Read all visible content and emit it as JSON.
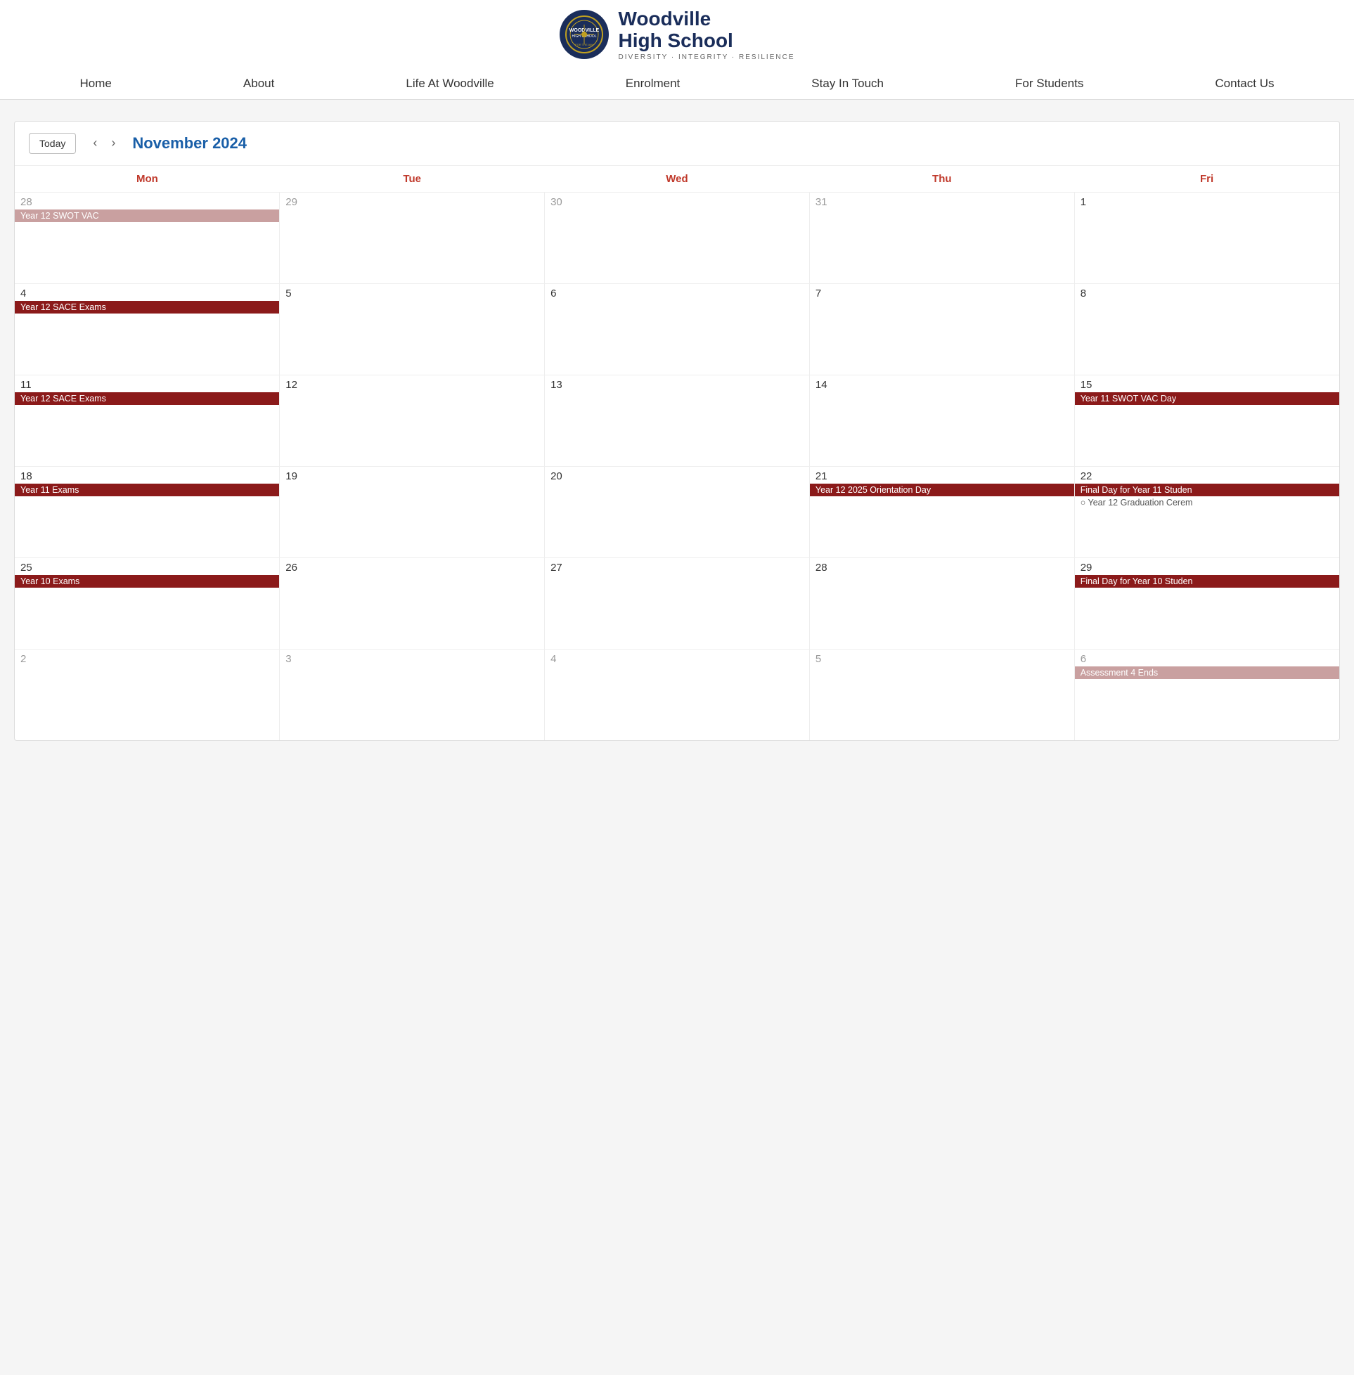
{
  "header": {
    "school_name": "Woodville",
    "school_name2": "High School",
    "tagline": "DIVERSITY · INTEGRITY · RESILIENCE",
    "nav": [
      {
        "label": "Home",
        "id": "home"
      },
      {
        "label": "About",
        "id": "about"
      },
      {
        "label": "Life At Woodville",
        "id": "life"
      },
      {
        "label": "Enrolment",
        "id": "enrolment"
      },
      {
        "label": "Stay In Touch",
        "id": "stay"
      },
      {
        "label": "For Students",
        "id": "students"
      },
      {
        "label": "Contact Us",
        "id": "contact"
      }
    ]
  },
  "calendar": {
    "today_label": "Today",
    "month_title": "November 2024",
    "days": [
      "Mon",
      "Tue",
      "Wed",
      "Thu",
      "Fri"
    ],
    "weeks": [
      {
        "dates": [
          "28",
          "29",
          "30",
          "31",
          "1"
        ],
        "active": [
          false,
          false,
          false,
          false,
          true
        ],
        "events": [
          {
            "label": "Year 12 SWOT VAC",
            "type": "lr",
            "colspan": 5,
            "start": 0
          }
        ]
      },
      {
        "dates": [
          "4",
          "5",
          "6",
          "7",
          "8"
        ],
        "active": [
          true,
          true,
          true,
          true,
          true
        ],
        "events": [
          {
            "label": "Year 12 SACE Exams",
            "type": "dr",
            "colspan": 5,
            "start": 0
          }
        ]
      },
      {
        "dates": [
          "11",
          "12",
          "13",
          "14",
          "15"
        ],
        "active": [
          true,
          true,
          true,
          true,
          true
        ],
        "events": [
          {
            "label": "Year 12 SACE Exams",
            "type": "dr",
            "colspan": 4,
            "start": 0
          },
          {
            "label": "Year 11 SWOT VAC Day",
            "type": "dr",
            "colspan": 1,
            "start": 4
          }
        ]
      },
      {
        "dates": [
          "18",
          "19",
          "20",
          "21",
          "22"
        ],
        "active": [
          true,
          true,
          true,
          true,
          true
        ],
        "events": [
          {
            "label": "Year 11 Exams",
            "type": "dr",
            "colspan": 3,
            "start": 0
          },
          {
            "label": "Year 12 2025 Orientation Day",
            "type": "dr",
            "colspan": 2,
            "start": 3
          },
          {
            "label": "Final Day for Year 11 Studen",
            "type": "dr",
            "colspan": 1,
            "start": 4,
            "row2": true
          },
          {
            "label": "Year 12 Graduation Cerem",
            "type": "dot",
            "colspan": 1,
            "start": 4,
            "row2": true
          }
        ]
      },
      {
        "dates": [
          "25",
          "26",
          "27",
          "28",
          "29"
        ],
        "active": [
          true,
          true,
          true,
          true,
          true
        ],
        "events": [
          {
            "label": "Year 10 Exams",
            "type": "dr",
            "colspan": 3,
            "start": 0
          },
          {
            "label": "Final Day for Year 10 Studen",
            "type": "dr",
            "colspan": 1,
            "start": 4
          }
        ]
      },
      {
        "dates": [
          "2",
          "3",
          "4",
          "5",
          "6"
        ],
        "active": [
          false,
          false,
          false,
          false,
          false
        ],
        "events": [
          {
            "label": "Assessment 4 Ends",
            "type": "lr",
            "colspan": 1,
            "start": 4
          }
        ]
      }
    ]
  }
}
